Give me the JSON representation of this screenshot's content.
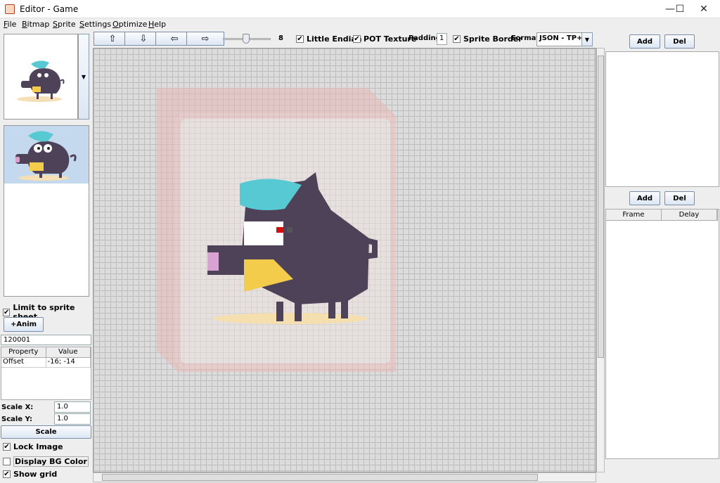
{
  "window": {
    "title": "Editor - Game",
    "minimize": "—",
    "maximize": "☐",
    "close": "✕"
  },
  "menu": [
    "File",
    "Bitmap",
    "Sprite",
    "Settings",
    "Optimize",
    "Help"
  ],
  "left": {
    "limit_label": "Limit to sprite sheet",
    "anim_button": "+Anim",
    "sprite_id": "120001",
    "prop_headers": [
      "Property",
      "Value"
    ],
    "prop_rows": [
      {
        "property": "Offset",
        "value": "-16; -14"
      }
    ],
    "scale_x_label": "Scale X:",
    "scale_x_value": "1.0",
    "scale_y_label": "Scale Y:",
    "scale_y_value": "1.0",
    "scale_button": "Scale",
    "lock_image_label": "Lock Image",
    "display_bg_label": "Display BG Color",
    "show_grid_label": "Show grid",
    "checks": {
      "limit": true,
      "lock_image": true,
      "display_bg": false,
      "show_grid": true
    }
  },
  "toolbar": {
    "up": "⇧",
    "down": "⇩",
    "left": "⇦",
    "right": "⇨",
    "zoom_level": 8,
    "zoom_fraction": 0.45,
    "little_endian": "Little Endian",
    "pot_texture": "POT Texture",
    "padding_label": "Padding:",
    "padding_value": "1",
    "sprite_border": "Sprite Border",
    "format_label": "Format:",
    "format_value": "JSON - TP+...",
    "checks": {
      "little_endian": true,
      "pot_texture": true,
      "sprite_border": true
    }
  },
  "right": {
    "add": "Add",
    "del": "Del",
    "frame_header": "Frame",
    "delay_header": "Delay"
  },
  "colors": {
    "boar": "#4e4258",
    "hat": "#56c9d3",
    "cheese": "#f2cc4a",
    "frame": "#e8a4a4"
  }
}
